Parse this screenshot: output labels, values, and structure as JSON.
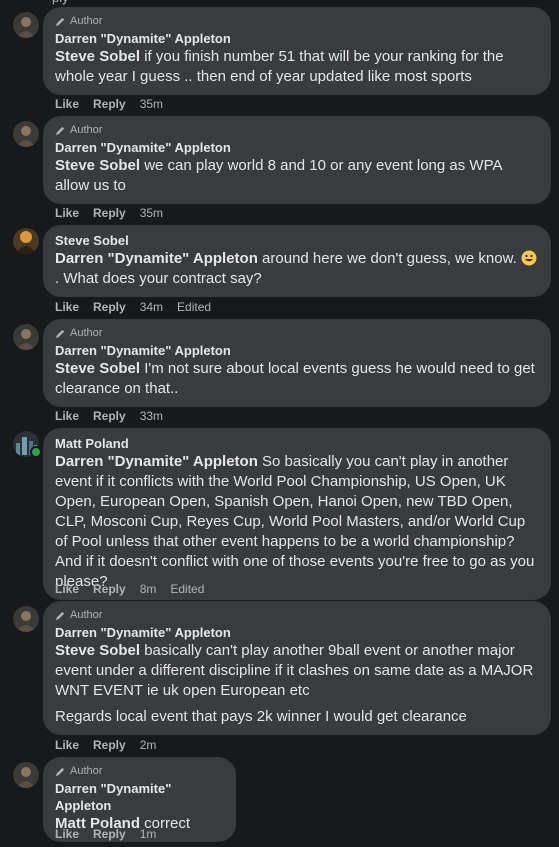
{
  "top_clip": "ply",
  "actions_labels": {
    "like": "Like",
    "reply": "Reply"
  },
  "author_badge_label": "Author",
  "comments": [
    {
      "author": "Darren \"Dynamite\" Appleton",
      "is_author": true,
      "mention": "Steve Sobel",
      "text": " if you finish number 51 that will be your ranking for the whole year I guess .. then end of year updated like most sports",
      "time": "35m",
      "edited": ""
    },
    {
      "author": "Darren \"Dynamite\" Appleton",
      "is_author": true,
      "mention": "Steve Sobel",
      "text": " we can play world 8 and 10 or any event long as WPA allow us to",
      "time": "35m",
      "edited": ""
    },
    {
      "author": "Steve Sobel",
      "is_author": false,
      "mention": "Darren \"Dynamite\" Appleton",
      "text": " around here we don't guess, we know.",
      "text_after_emoji": ". What does your contract say?",
      "time": "34m",
      "edited": "Edited"
    },
    {
      "author": "Darren \"Dynamite\" Appleton",
      "is_author": true,
      "mention": "Steve Sobel",
      "text": " I'm not sure about local events guess he would need to get clearance on that..",
      "time": "33m",
      "edited": ""
    },
    {
      "author": "Matt Poland",
      "is_author": false,
      "mention": "Darren \"Dynamite\" Appleton",
      "text": " So basically you can't play in another event if it conflicts with the World Pool Championship, US Open, UK Open, European Open, Spanish Open, Hanoi Open, new TBD Open, CLP, Mosconi Cup, Reyes Cup, World Pool Masters, and/or World Cup of Pool unless that other event happens to be a world championship? And if it doesn't conflict with one of those events you're free to go as you please?",
      "time": "8m",
      "edited": "Edited"
    },
    {
      "author": "Darren \"Dynamite\" Appleton",
      "is_author": true,
      "mention": "Steve Sobel",
      "text": " basically can't play another 9ball event or another major event under a different discipline if it clashes on same date as a MAJOR WNT EVENT ie uk open European etc",
      "text_para2": "Regards local event that pays 2k winner I would get clearance",
      "time": "2m",
      "edited": ""
    },
    {
      "author": "Darren \"Dynamite\" Appleton",
      "is_author": true,
      "mention": "Matt Poland",
      "text": " correct",
      "time": "1m",
      "edited": ""
    }
  ],
  "colors": {
    "background": "#18191a",
    "bubble": "#3a3b3c",
    "text": "#e4e6eb",
    "secondary": "#b0b3b8",
    "online": "#31a24c"
  },
  "icons": {
    "author_badge": "pen-icon",
    "emoji": "smiling-face-emoji"
  }
}
